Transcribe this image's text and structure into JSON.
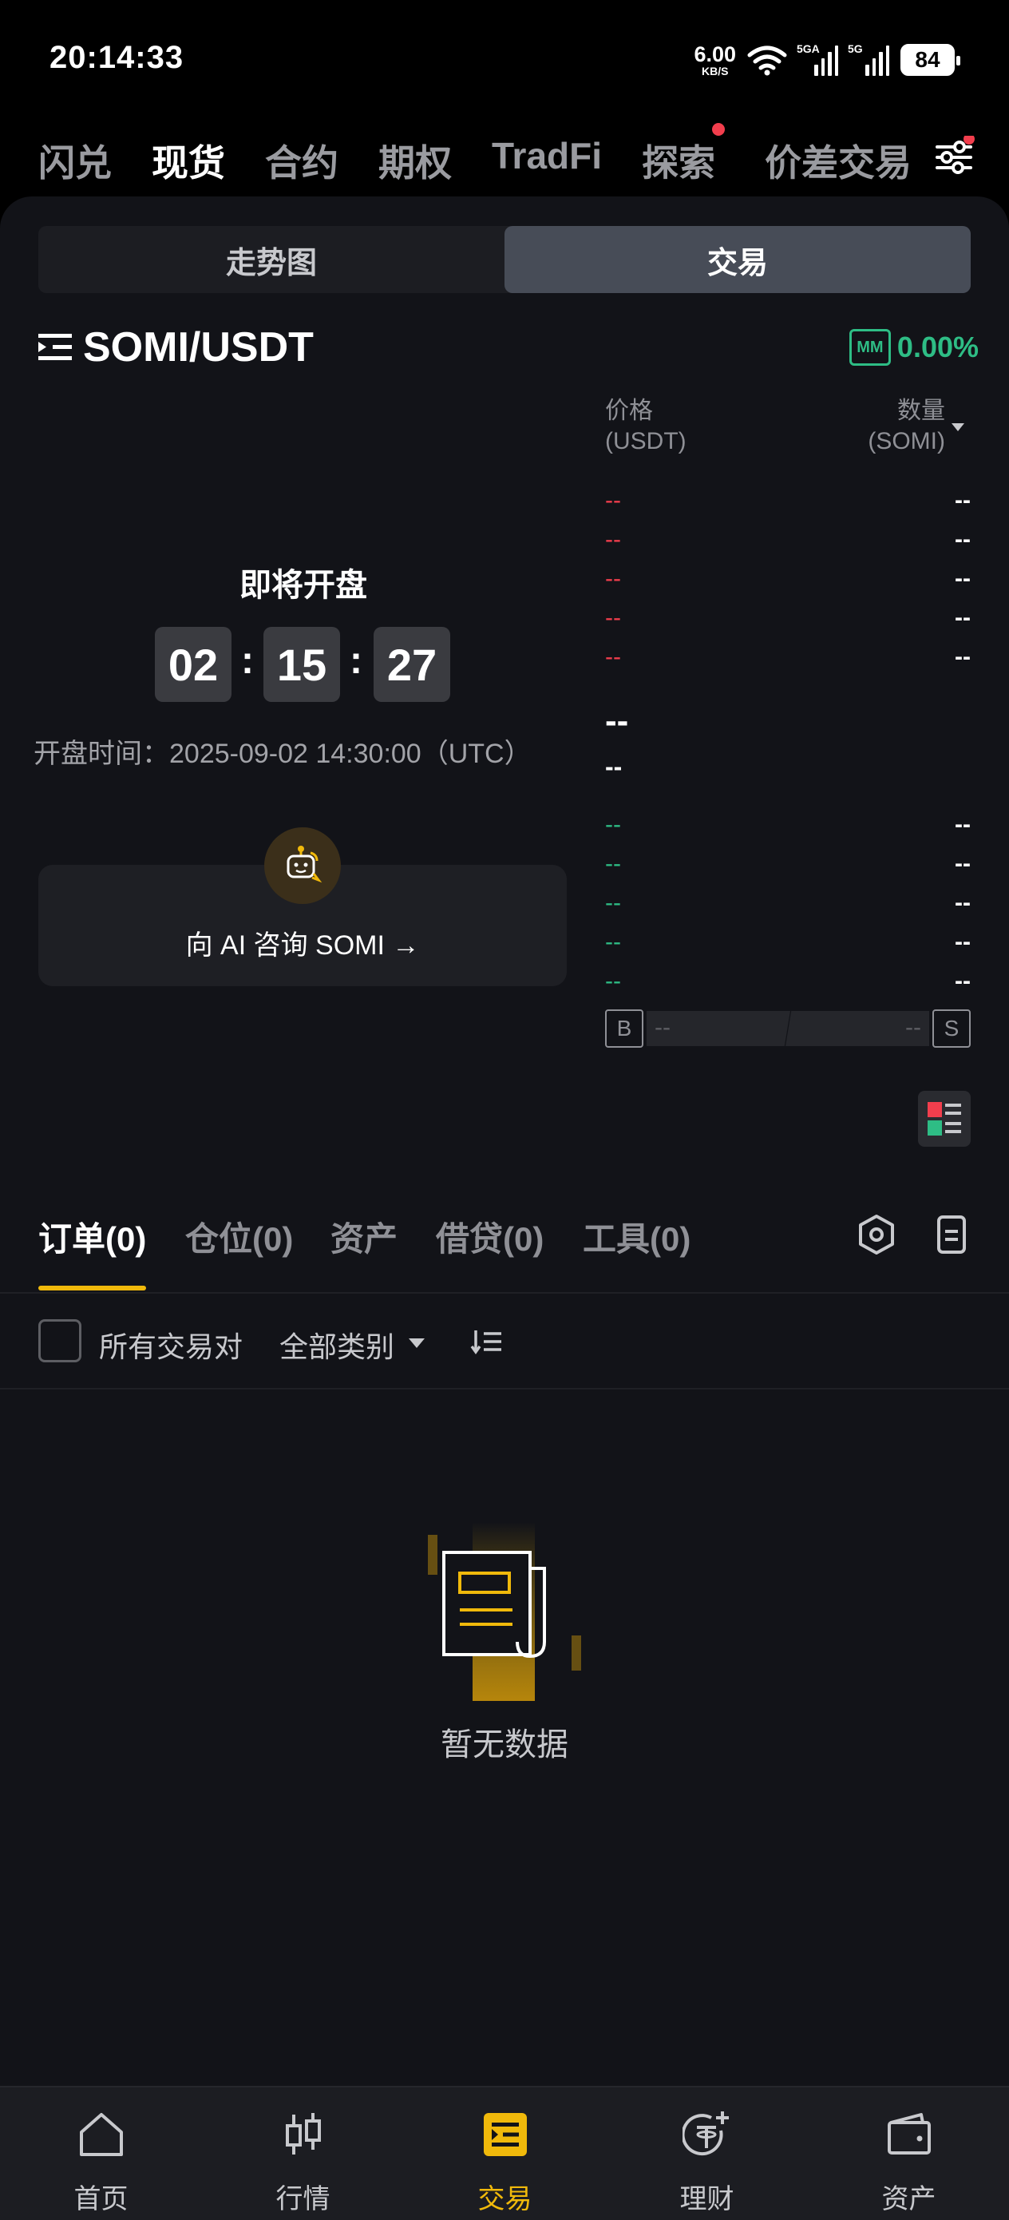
{
  "status_bar": {
    "time": "20:14:33",
    "net_speed_value": "6.00",
    "net_speed_unit": "KB/S",
    "sim1_label": "5GA",
    "sim2_label": "5G",
    "battery": "84"
  },
  "top_tabs": [
    {
      "label": "闪兑",
      "active": false
    },
    {
      "label": "现货",
      "active": true
    },
    {
      "label": "合约",
      "active": false
    },
    {
      "label": "期权",
      "active": false
    },
    {
      "label": "TradFi",
      "active": false
    },
    {
      "label": "探索",
      "active": false,
      "dot": true
    },
    {
      "label": "价差交易",
      "active": false
    }
  ],
  "segment": {
    "chart_label": "走势图",
    "trade_label": "交易",
    "selected": "交易"
  },
  "pair": {
    "name": "SOMI/USDT",
    "mm_badge": "MM",
    "change": "0.00%"
  },
  "countdown": {
    "label": "即将开盘",
    "hours": "02",
    "minutes": "15",
    "seconds": "27",
    "separator": ":",
    "open_time": "开盘时间：2025-09-02 14:30:00（UTC）"
  },
  "ai_card": {
    "text": "向 AI 咨询 SOMI →"
  },
  "order_book": {
    "price_header": "价格",
    "price_unit": "(USDT)",
    "qty_header": "数量",
    "qty_unit": "(SOMI)",
    "asks": [
      {
        "price": "--",
        "qty": "--"
      },
      {
        "price": "--",
        "qty": "--"
      },
      {
        "price": "--",
        "qty": "--"
      },
      {
        "price": "--",
        "qty": "--"
      },
      {
        "price": "--",
        "qty": "--"
      }
    ],
    "mid_price": "--",
    "mid_sub": "--",
    "bids": [
      {
        "price": "--",
        "qty": "--"
      },
      {
        "price": "--",
        "qty": "--"
      },
      {
        "price": "--",
        "qty": "--"
      },
      {
        "price": "--",
        "qty": "--"
      },
      {
        "price": "--",
        "qty": "--"
      }
    ],
    "buy_label": "B",
    "sell_label": "S",
    "buy_ratio": "--",
    "sell_ratio": "--"
  },
  "order_tabs": [
    {
      "label": "订单(0)",
      "active": true
    },
    {
      "label": "仓位(0)",
      "active": false
    },
    {
      "label": "资产",
      "active": false
    },
    {
      "label": "借贷(0)",
      "active": false
    },
    {
      "label": "工具(0)",
      "active": false
    }
  ],
  "filters": {
    "all_pairs": "所有交易对",
    "category": "全部类别"
  },
  "empty_state": {
    "text": "暂无数据"
  },
  "bottom_nav": [
    {
      "label": "首页",
      "icon": "home-icon",
      "active": false
    },
    {
      "label": "行情",
      "icon": "market-icon",
      "active": false
    },
    {
      "label": "交易",
      "icon": "trade-icon",
      "active": true
    },
    {
      "label": "理财",
      "icon": "earn-icon",
      "active": false
    },
    {
      "label": "资产",
      "icon": "wallet-icon",
      "active": false
    }
  ],
  "colors": {
    "accent": "#f0b90b",
    "up": "#2ebd85",
    "down": "#f23e4d",
    "background": "#121318"
  }
}
